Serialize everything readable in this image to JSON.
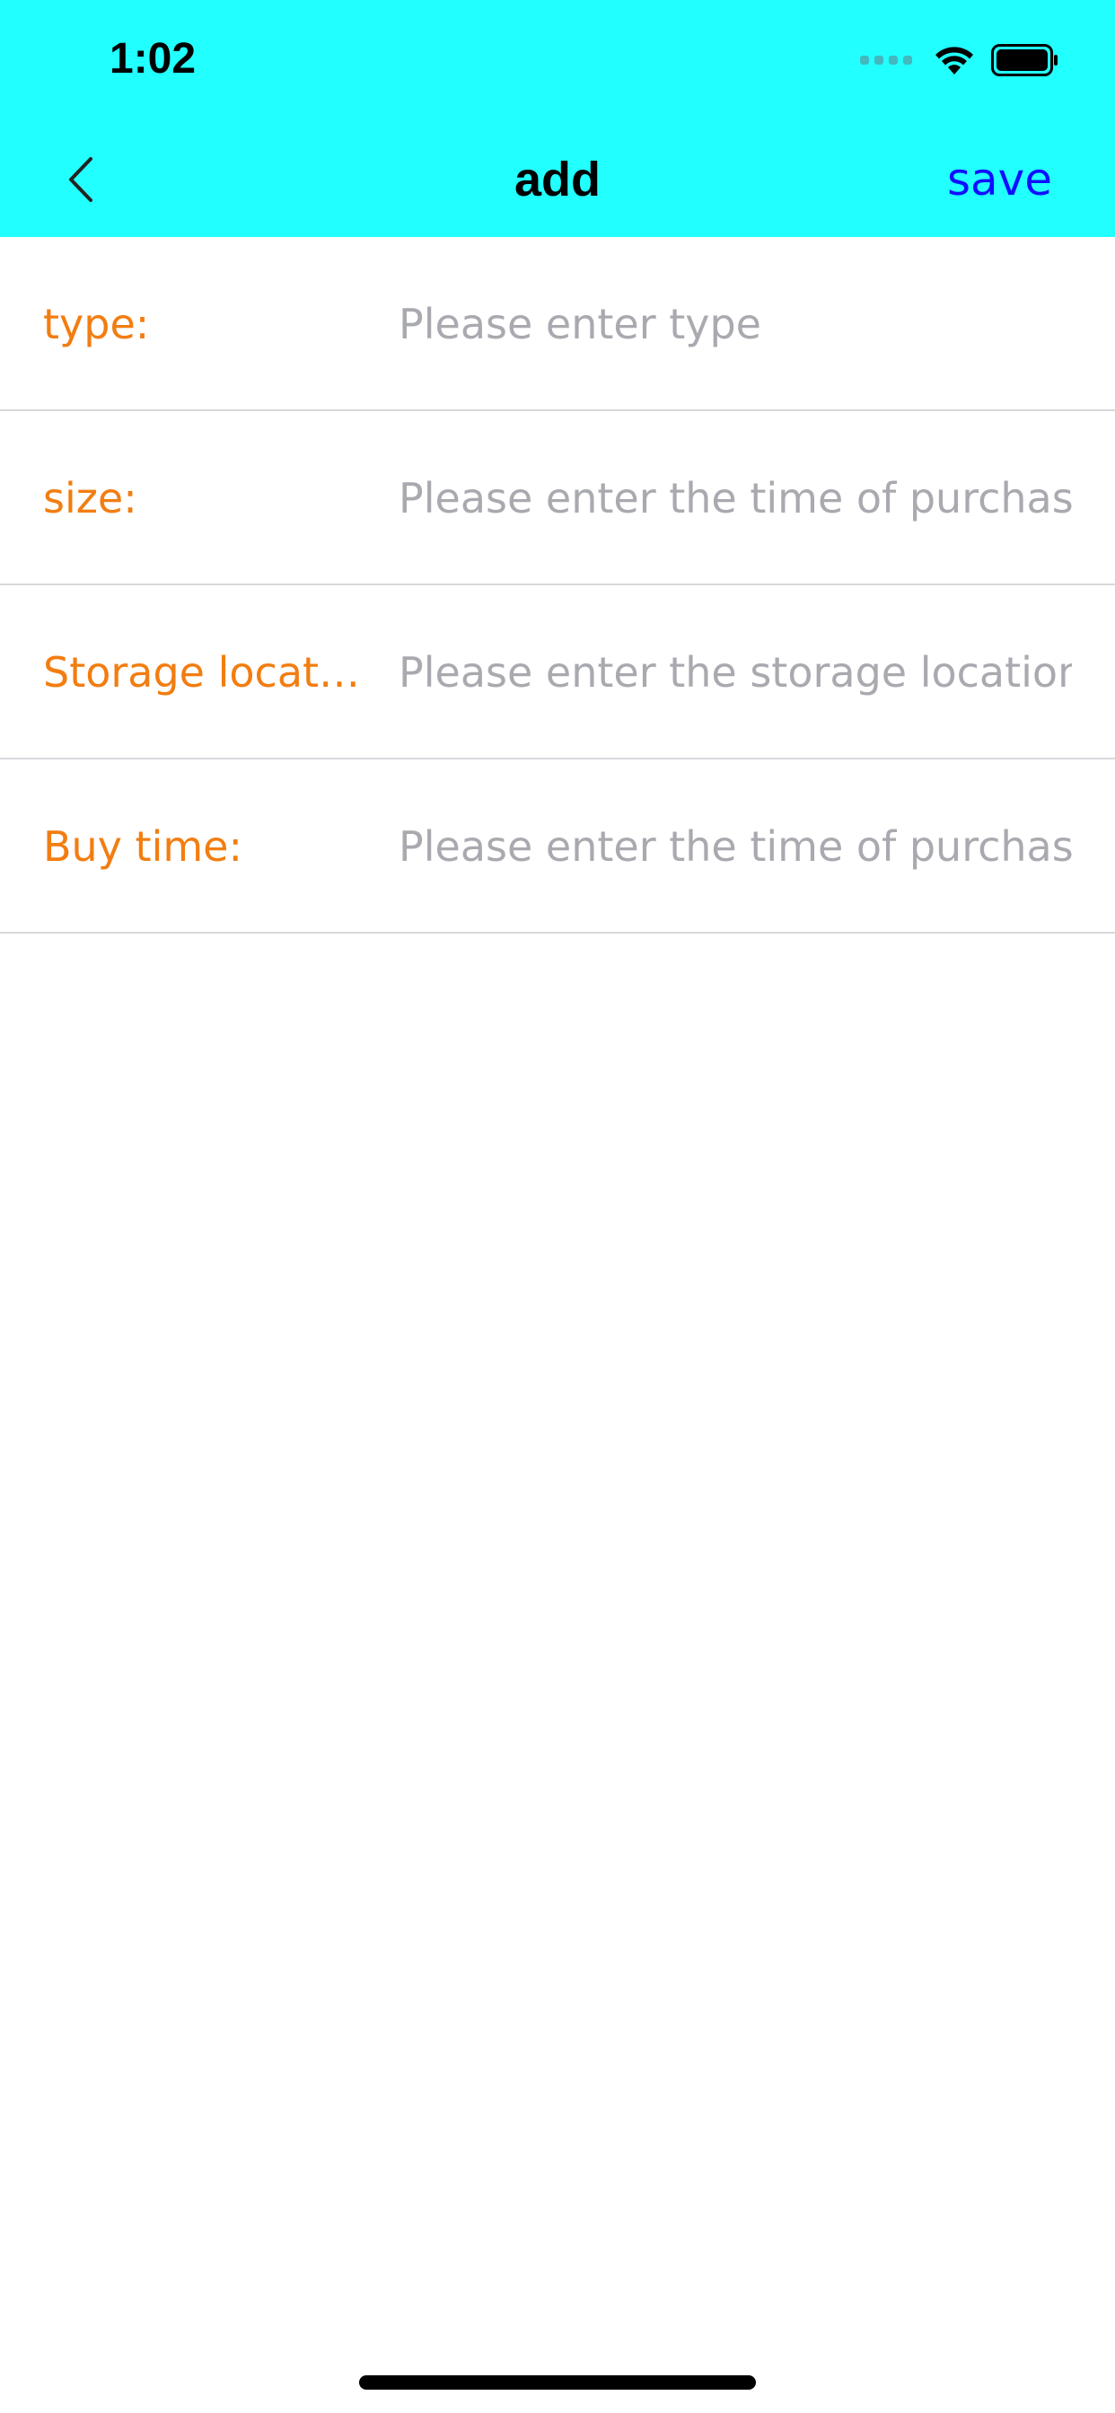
{
  "status_bar": {
    "time": "1:02",
    "signal_icon": "signal-dots-icon",
    "wifi_icon": "wifi-icon",
    "battery_icon": "battery-icon"
  },
  "nav": {
    "back_icon": "chevron-left-icon",
    "title": "add",
    "save_label": "save"
  },
  "form": {
    "rows": [
      {
        "label": "type:",
        "placeholder": "Please enter type",
        "value": ""
      },
      {
        "label": "size:",
        "placeholder": "Please enter the time of purchase",
        "value": ""
      },
      {
        "label": "Storage location:",
        "placeholder": "Please enter the storage location",
        "value": ""
      },
      {
        "label": "Buy time:",
        "placeholder": "Please enter the time of purchase",
        "value": ""
      }
    ]
  },
  "colors": {
    "nav_background": "#22FFFF",
    "label_color": "#F27D11",
    "save_color": "#1010FF",
    "placeholder_color": "#A9AAB0"
  }
}
